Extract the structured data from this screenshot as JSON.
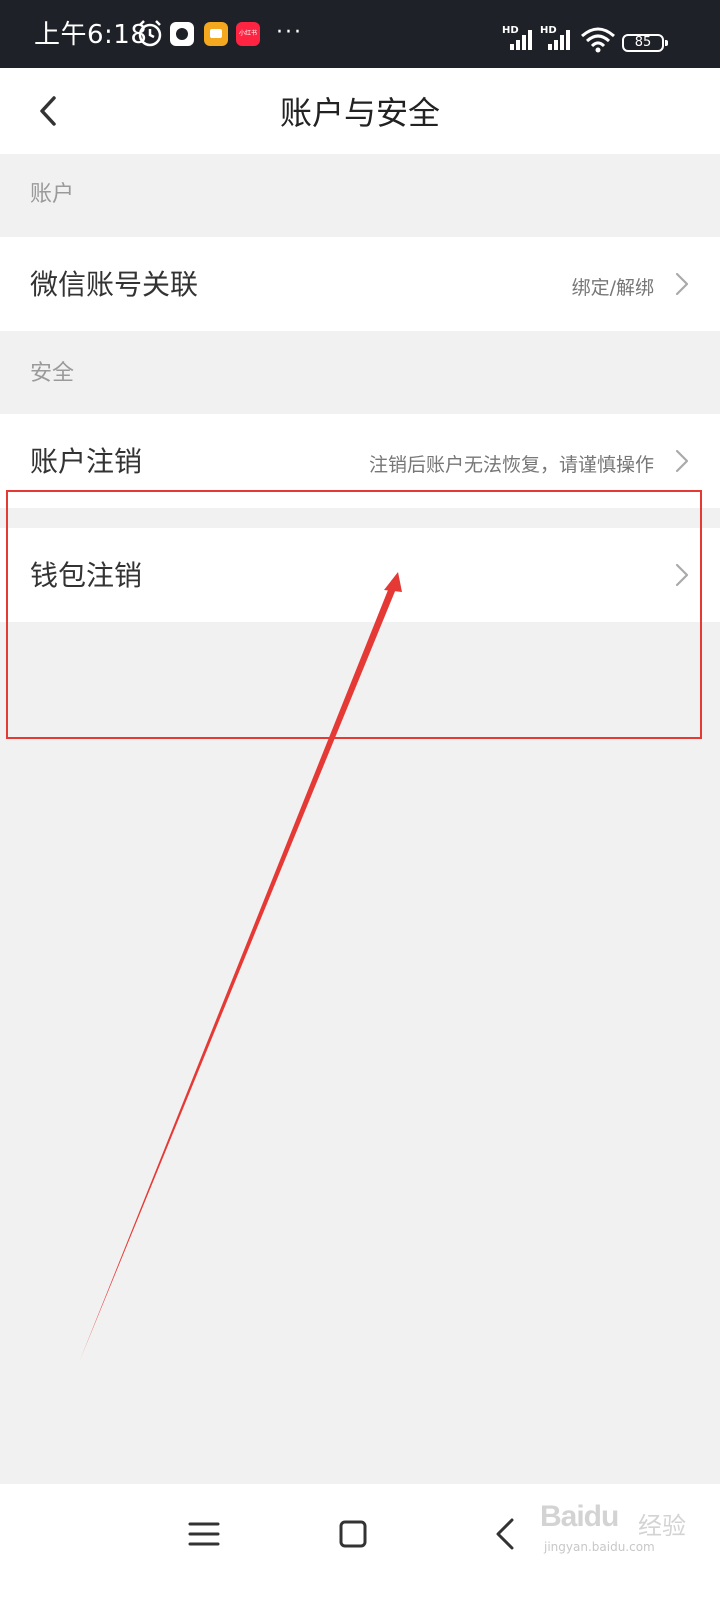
{
  "status_bar": {
    "time": "上午6:18",
    "app_badge_text": "小红书",
    "more": "···",
    "battery": "85",
    "network": "HD",
    "icons": [
      "alarm-icon",
      "app-icon",
      "app-icon",
      "app-icon",
      "signal-icon",
      "signal-icon",
      "wifi-icon",
      "battery-icon"
    ]
  },
  "header": {
    "title": "账户与安全"
  },
  "sections": [
    {
      "label": "账户",
      "items": [
        {
          "title": "微信账号关联",
          "subtitle": "绑定/解绑"
        }
      ]
    },
    {
      "label": "安全",
      "items": [
        {
          "title": "账户注销",
          "subtitle": "注销后账户无法恢复，请谨慎操作"
        },
        {
          "title": "钱包注销",
          "subtitle": ""
        }
      ]
    }
  ],
  "annotation": {
    "color": "#e53935"
  },
  "nav_bar": {
    "buttons": [
      "menu-icon",
      "home-icon",
      "back-icon"
    ]
  },
  "watermark": {
    "logo": "Baidu",
    "text": "经验",
    "url": "jingyan.baidu.com"
  },
  "colors": {
    "background": "#f1f1f1",
    "status_bar": "#1f2128",
    "accent": "#e53935"
  }
}
